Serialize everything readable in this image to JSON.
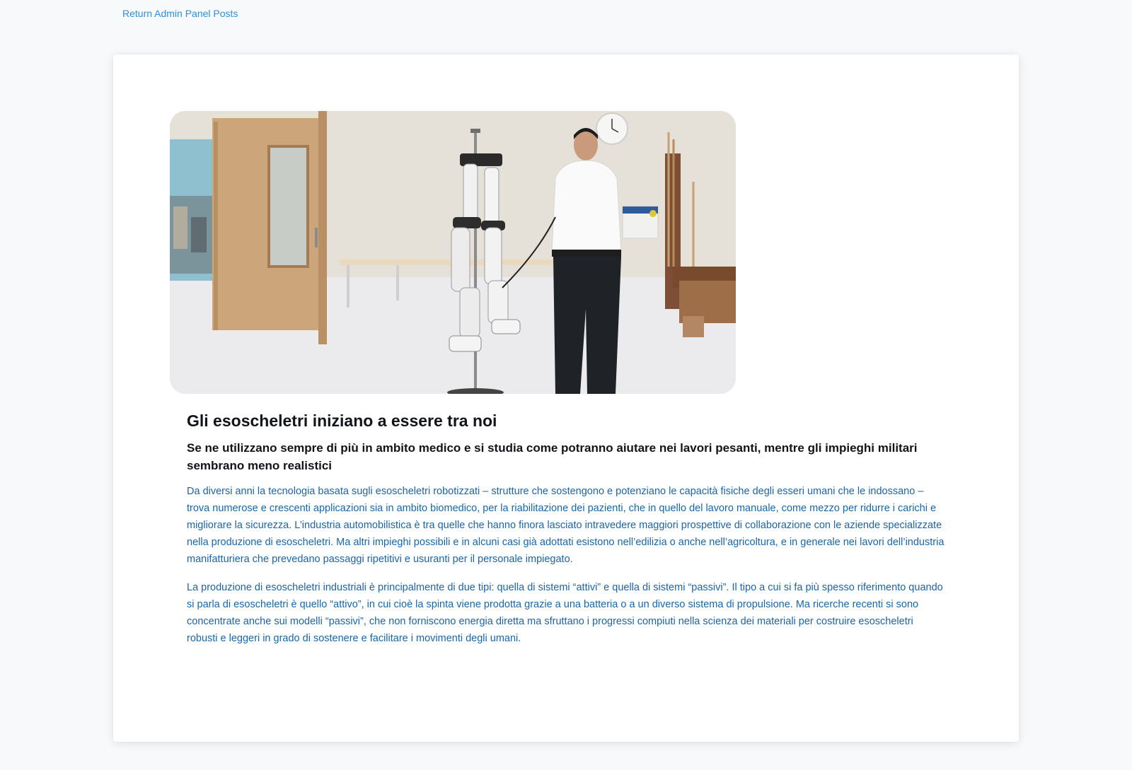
{
  "nav": {
    "back_link": "Return Admin Panel Posts"
  },
  "post": {
    "image_alt": "Esoscheletro robotico in una stanza di riabilitazione con un uomo",
    "title": "Gli esoscheletri iniziano a essere tra noi",
    "subtitle": "Se ne utilizzano sempre di più in ambito medico e si studia come potranno aiutare nei lavori pesanti, mentre gli impieghi militari sembrano meno realistici",
    "paragraphs": [
      "Da diversi anni la tecnologia basata sugli esoscheletri robotizzati – strutture che sostengono e potenziano le capacità fisiche degli esseri umani che le indossano – trova numerose e crescenti applicazioni sia in ambito biomedico, per la riabilitazione dei pazienti, che in quello del lavoro manuale, come mezzo per ridurre i carichi e migliorare la sicurezza. L’industria automobilistica è tra quelle che hanno finora lasciato intravedere maggiori prospettive di collaborazione con le aziende specializzate nella produzione di esoscheletri. Ma altri impieghi possibili e in alcuni casi già adottati esistono nell’edilizia o anche nell’agricoltura, e in generale nei lavori dell’industria manifatturiera che prevedano passaggi ripetitivi e usuranti per il personale impiegato.",
      "La produzione di esoscheletri industriali è principalmente di due tipi: quella di sistemi “attivi” e quella di sistemi “passivi”. Il tipo a cui si fa più spesso riferimento quando si parla di esoscheletri è quello “attivo”, in cui cioè la spinta viene prodotta grazie a una batteria o a un diverso sistema di propulsione. Ma ricerche recenti si sono concentrate anche sui modelli “passivi”, che non forniscono energia diretta ma sfruttano i progressi compiuti nella scienza dei materiali per costruire esoscheletri robusti e leggeri in grado di sostenere e facilitare i movimenti degli umani."
    ]
  },
  "colors": {
    "page_bg": "#f7f9fb",
    "link": "#2f8fd8",
    "paragraph": "#1b64a6",
    "heading": "#111418"
  }
}
